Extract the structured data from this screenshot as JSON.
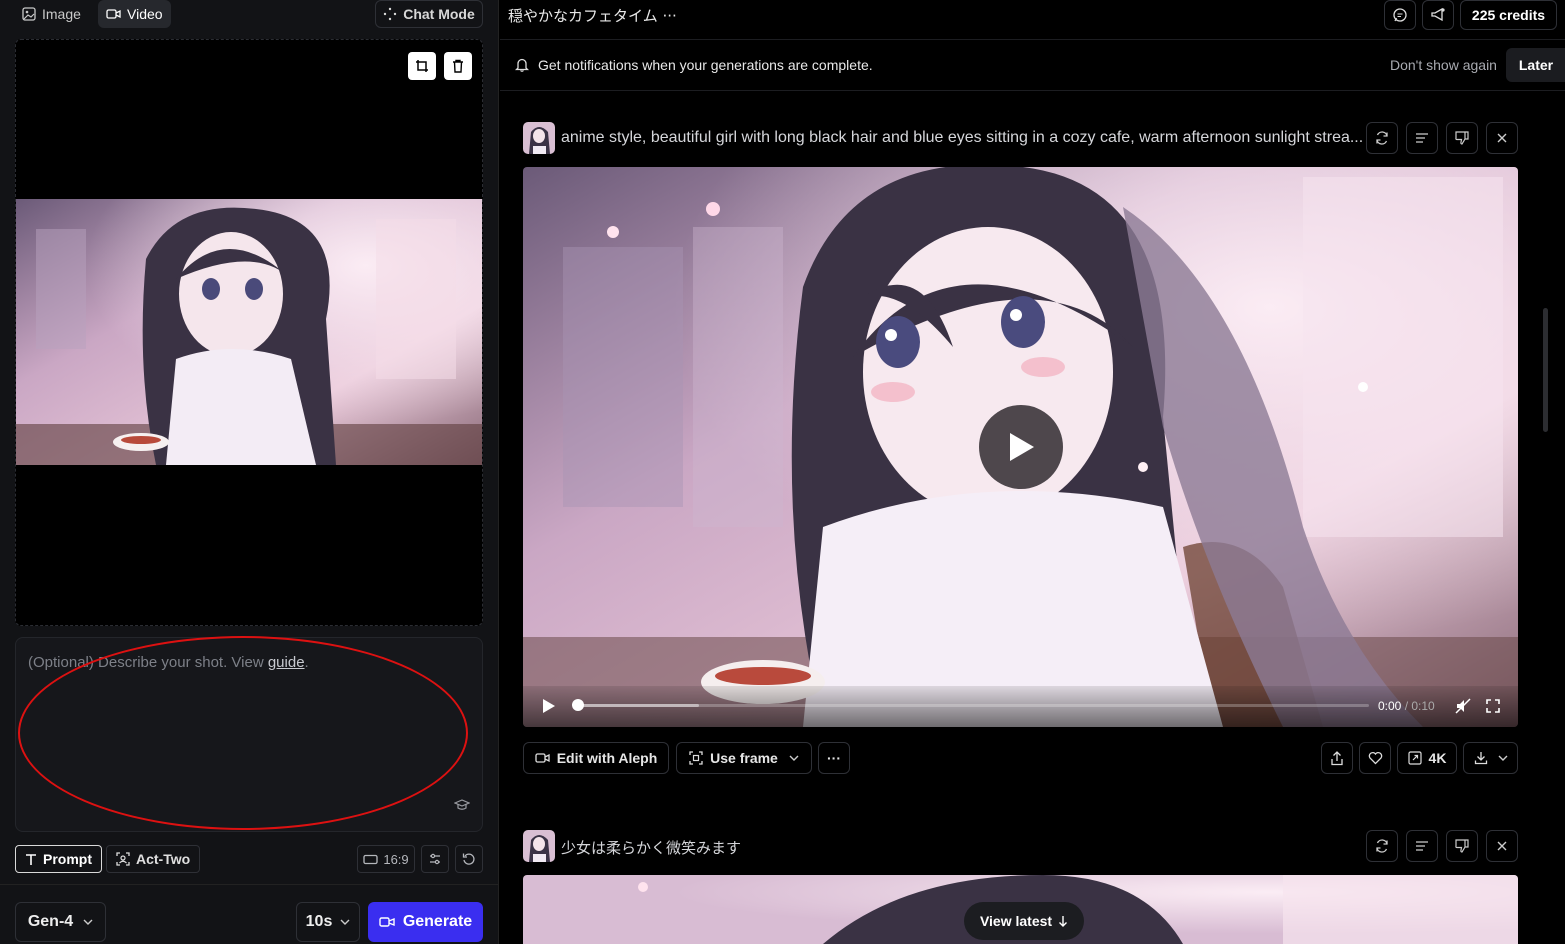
{
  "left_panel": {
    "tabs": [
      {
        "label": "Image",
        "icon": "image-icon"
      },
      {
        "label": "Video",
        "icon": "video-icon",
        "active": true
      }
    ],
    "chat_mode_label": "Chat Mode",
    "prompt": {
      "placeholder_prefix": "(Optional) Describe your shot. View ",
      "guide_link": "guide",
      "placeholder_suffix": "."
    },
    "tools": {
      "prompt_label": "Prompt",
      "act_two_label": "Act-Two",
      "aspect_ratio": "16:9"
    },
    "model": "Gen-4",
    "duration": "10s",
    "generate_label": "Generate"
  },
  "header": {
    "session_title": "穏やかなカフェタイム",
    "more": "···",
    "credits": "225 credits"
  },
  "notification": {
    "text": "Get notifications when your generations are complete.",
    "dont_show": "Don't show again",
    "later": "Later"
  },
  "generations": [
    {
      "prompt": "anime style, beautiful girl with long black hair and blue eyes sitting in a cozy cafe, warm afternoon sunlight strea...",
      "player": {
        "current": "0:00",
        "separator": " / ",
        "duration": "0:10",
        "progress": 0.0
      },
      "actions": {
        "edit_label": "Edit with Aleph",
        "use_frame_label": "Use frame",
        "more": "···",
        "upscale_label": "4K"
      }
    },
    {
      "prompt": "少女は柔らかく微笑みます"
    }
  ],
  "view_latest_label": "View latest",
  "colors": {
    "accent": "#3a2ef0",
    "annotation": "#dd1111"
  }
}
